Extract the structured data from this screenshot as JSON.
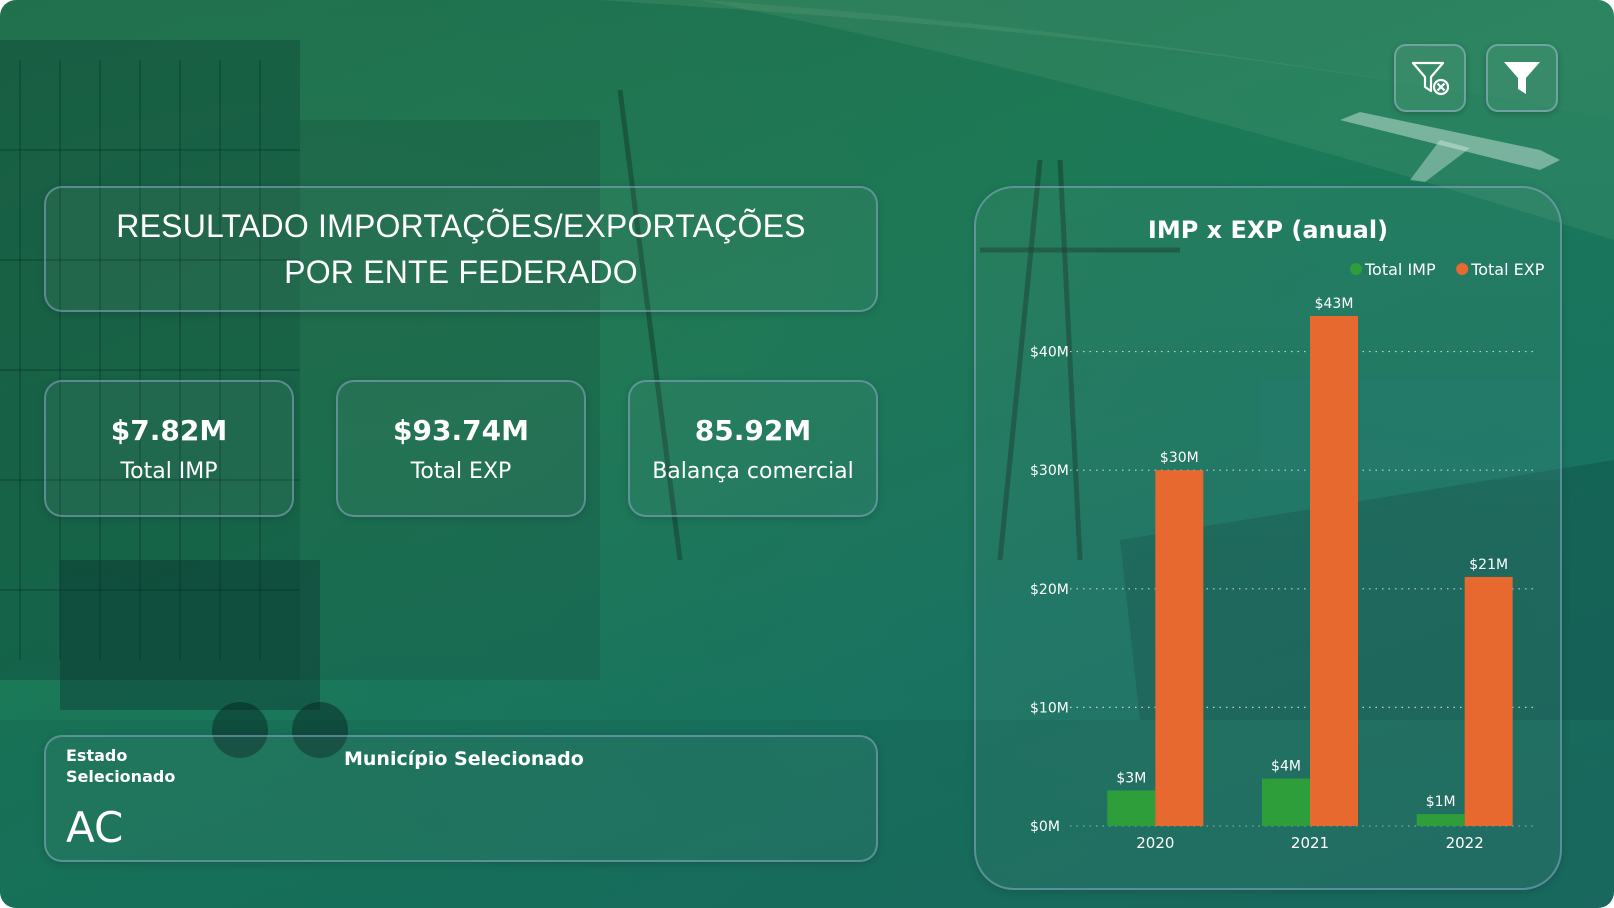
{
  "header": {
    "title_line1": "RESULTADO IMPORTAÇÕES/EXPORTAÇÕES",
    "title_line2": "POR ENTE FEDERADO"
  },
  "toolbar": {
    "clear_filters_icon": "filter-clear-icon",
    "filter_icon": "filter-icon"
  },
  "kpis": [
    {
      "value": "$7.82M",
      "label": "Total IMP"
    },
    {
      "value": "$93.74M",
      "label": "Total EXP"
    },
    {
      "value": "85.92M",
      "label": "Balança comercial"
    }
  ],
  "selection": {
    "estado_label": "Estado Selecionado",
    "estado_value": "AC",
    "municipio_label": "Município Selecionado"
  },
  "colors": {
    "imp": "#2e9e3a",
    "exp": "#e8692f"
  },
  "chart_data": {
    "type": "bar",
    "title": "IMP x EXP (anual)",
    "categories": [
      "2020",
      "2021",
      "2022"
    ],
    "series": [
      {
        "name": "Total IMP",
        "values": [
          3,
          4,
          1
        ],
        "labels": [
          "$3M",
          "$4M",
          "$1M"
        ]
      },
      {
        "name": "Total EXP",
        "values": [
          30,
          43,
          21
        ],
        "labels": [
          "$30M",
          "$43M",
          "$21M"
        ]
      }
    ],
    "yticks": [
      0,
      10,
      20,
      30,
      40
    ],
    "ytick_labels": [
      "$0M",
      "$10M",
      "$20M",
      "$30M",
      "$40M"
    ],
    "ylim": [
      0,
      43
    ],
    "grid": true,
    "legend_position": "top-right"
  }
}
